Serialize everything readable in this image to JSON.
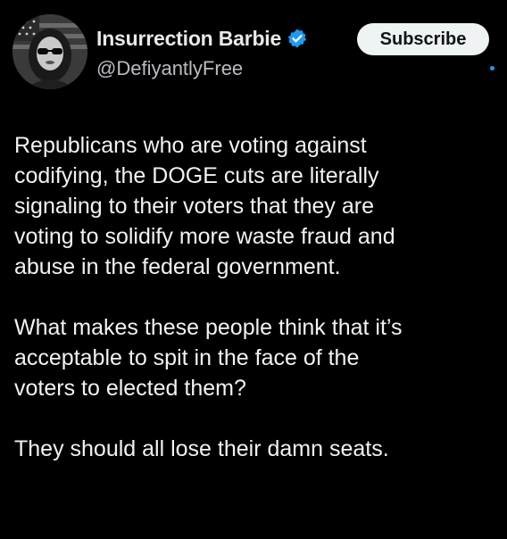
{
  "author": {
    "display_name": "Insurrection Barbie",
    "handle": "@DefiyantlyFree",
    "avatar_icon": "profile-photo",
    "verified_icon": "verified-badge-icon",
    "verified_color": "#1d9bf0"
  },
  "actions": {
    "subscribe_label": "Subscribe"
  },
  "tweet": {
    "paragraphs": [
      "Republicans who are voting against\ncodifying, the DOGE cuts are literally\nsignaling to their voters that they are\nvoting to solidify more waste fraud and\nabuse in the federal government.",
      "What makes these people think that it’s\nacceptable to spit in the face of the\nvoters to elected them?",
      "They should all lose their damn seats."
    ]
  },
  "colors": {
    "background": "#000000",
    "text": "#e7e9ea",
    "secondary_text": "#b9bcc0",
    "accent": "#1d9bf0",
    "button_bg": "#eff3f4"
  }
}
